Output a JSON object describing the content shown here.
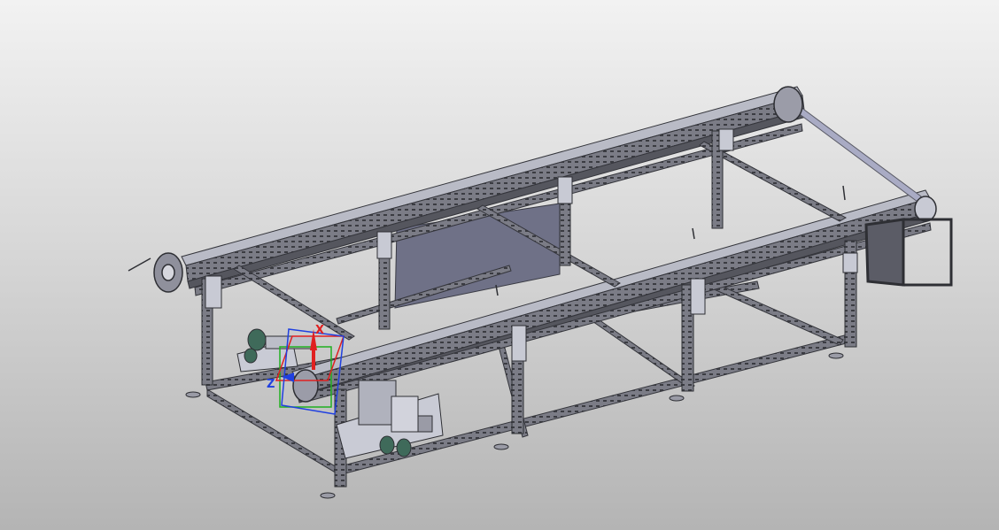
{
  "viewport": {
    "background_top": "#f2f2f2",
    "background_bottom": "#b4b4b4"
  },
  "model": {
    "frame_color": "#6e6f7a",
    "frame_dark": "#34353b",
    "frame_light": "#b9bbc6",
    "panel_color": "#6f7187",
    "shaft_color": "#a9abc4",
    "accent_green": "#3f6a5a"
  },
  "triad": {
    "x_color": "#e02020",
    "y_color": "#20b020",
    "z_color": "#2040e0",
    "x_label": "X",
    "z_label": "Z"
  }
}
